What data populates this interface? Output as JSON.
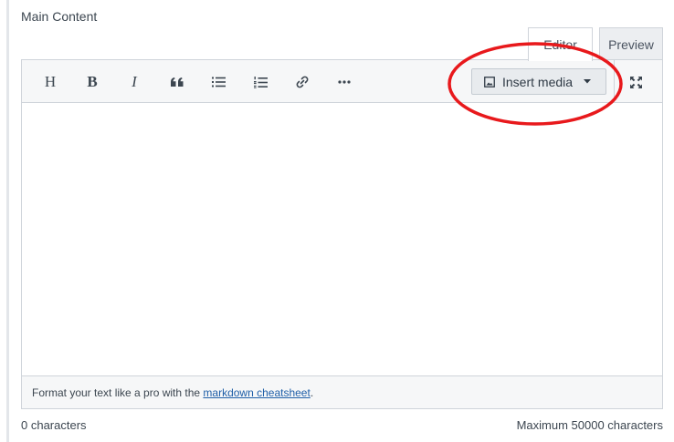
{
  "field": {
    "label": "Main Content"
  },
  "tabs": [
    {
      "label": "Editor",
      "active": true
    },
    {
      "label": "Preview",
      "active": false
    }
  ],
  "toolbar": {
    "buttons": [
      {
        "name": "heading",
        "glyph": "H"
      },
      {
        "name": "bold",
        "glyph": "B"
      },
      {
        "name": "italic",
        "glyph": "I"
      },
      {
        "name": "quote"
      },
      {
        "name": "bulleted-list"
      },
      {
        "name": "numbered-list"
      },
      {
        "name": "link"
      },
      {
        "name": "more"
      }
    ],
    "insert_media_label": "Insert media"
  },
  "editor": {
    "value": ""
  },
  "footer": {
    "hint_prefix": "Format your text like a pro with the ",
    "hint_link": "markdown cheatsheet",
    "hint_suffix": "."
  },
  "counts": {
    "current": "0 characters",
    "maximum": "Maximum 50000 characters"
  },
  "colors": {
    "annotation": "#e8191c",
    "link": "#1f5fa8",
    "toolbar_bg": "#f6f7f8"
  }
}
